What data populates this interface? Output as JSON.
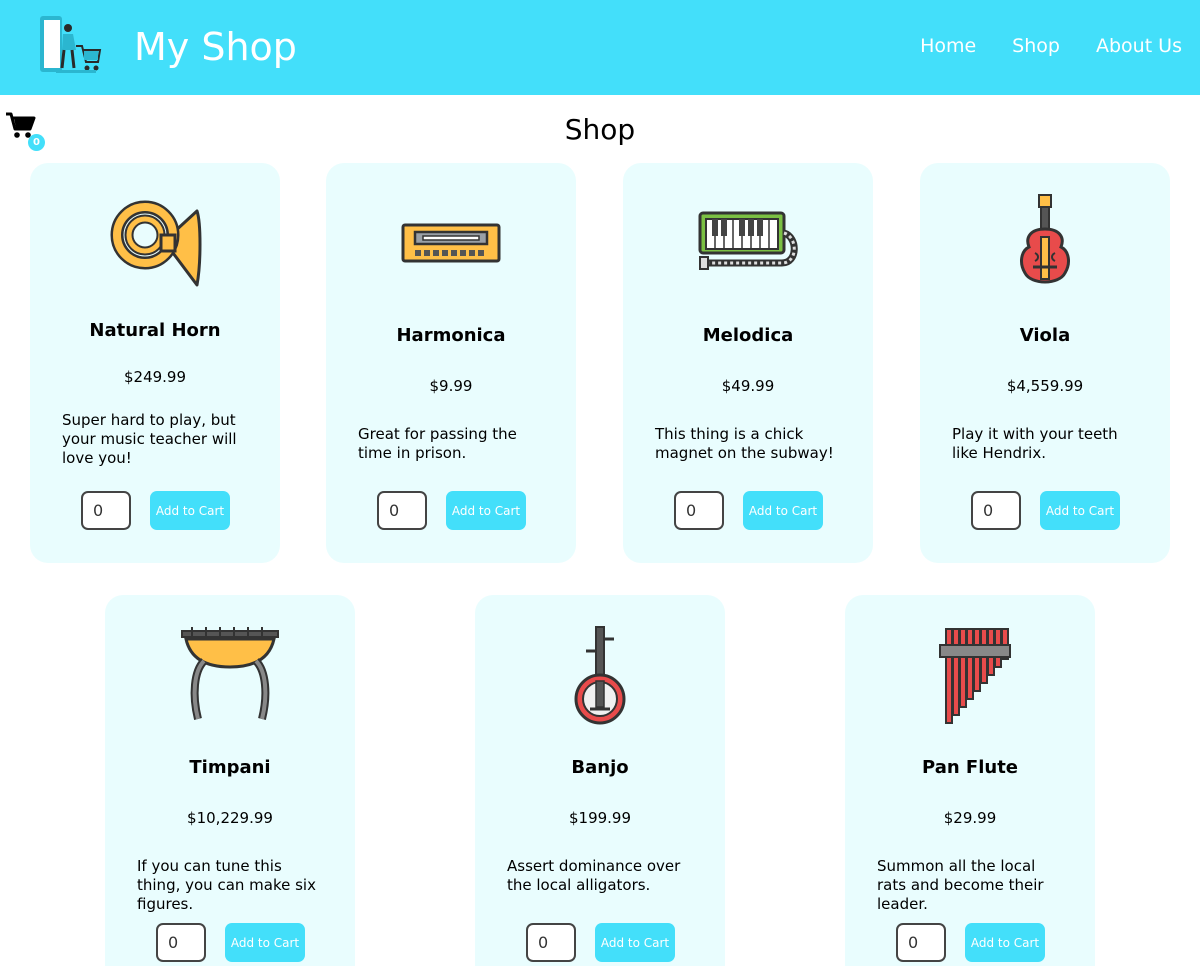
{
  "header": {
    "brand": "My Shop",
    "nav": [
      "Home",
      "Shop",
      "About Us"
    ]
  },
  "cart": {
    "count": "0"
  },
  "page_title": "Shop",
  "add_label": "Add to Cart",
  "qty_value": "0",
  "products": [
    {
      "name": "Natural Horn",
      "price": "$249.99",
      "desc": "Super hard to play, but your music teacher will love you!",
      "icon": "natural-horn-icon"
    },
    {
      "name": "Harmonica",
      "price": "$9.99",
      "desc": "Great for passing the time in prison.",
      "icon": "harmonica-icon"
    },
    {
      "name": "Melodica",
      "price": "$49.99",
      "desc": "This thing is a chick magnet on the subway!",
      "icon": "melodica-icon"
    },
    {
      "name": "Viola",
      "price": "$4,559.99",
      "desc": "Play it with your teeth like Hendrix.",
      "icon": "viola-icon"
    },
    {
      "name": "Timpani",
      "price": "$10,229.99",
      "desc": "If you can tune this thing, you can make six figures.",
      "icon": "timpani-icon"
    },
    {
      "name": "Banjo",
      "price": "$199.99",
      "desc": "Assert dominance over the local alligators.",
      "icon": "banjo-icon"
    },
    {
      "name": "Pan Flute",
      "price": "$29.99",
      "desc": "Summon all the local rats and become their leader.",
      "icon": "pan-flute-icon"
    }
  ],
  "colors": {
    "accent": "#43dffa",
    "card_bg": "#e9fdfe"
  }
}
